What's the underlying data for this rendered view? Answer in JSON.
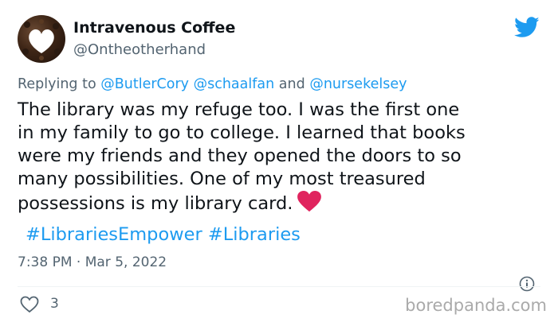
{
  "author": {
    "name": "Intravenous Coffee",
    "handle": "@Ontheotherhand",
    "avatar": "coffee-bean-heart-avatar"
  },
  "reply": {
    "prefix": "Replying to",
    "mention_1": "@ButlerCory",
    "mention_2": "@schaalfan",
    "joiner": "and",
    "mention_3": "@nursekelsey"
  },
  "tweet": {
    "lines": [
      "The library was my refuge too. I was the first one",
      "in my family to go to college. I learned that books",
      "were my friends and they opened the doors to so",
      "many possibilities. One of my most treasured",
      "possessions is my library card."
    ],
    "emoji": "red-heart",
    "hashtag_1": "#LibrariesEmpower",
    "hashtag_2": "#Libraries"
  },
  "meta": {
    "time": "7:38 PM",
    "separator": "·",
    "date": "Mar 5, 2022"
  },
  "engagement": {
    "likes": "3"
  },
  "watermark": "boredpanda.com",
  "colors": {
    "twitter_blue": "#1d9bf0",
    "heart_red": "#e0245e",
    "secondary_text": "#536471"
  }
}
